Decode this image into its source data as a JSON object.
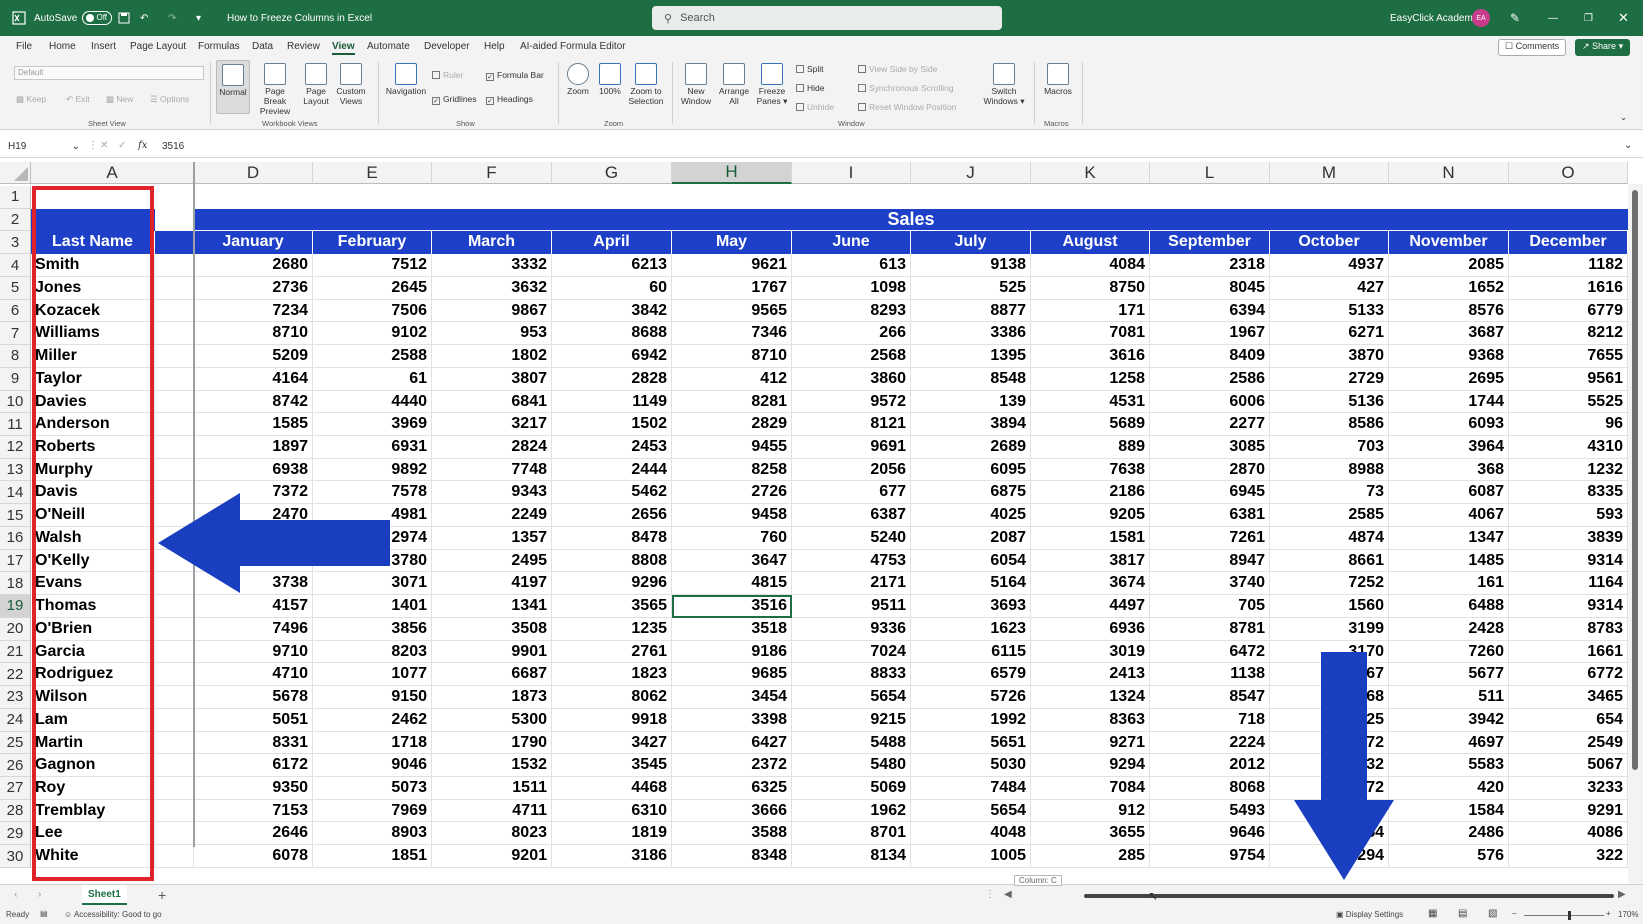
{
  "titlebar": {
    "autosave_label": "AutoSave",
    "autosave_state": "Off",
    "doc_title": "How to Freeze Columns in Excel",
    "search_placeholder": "Search",
    "account_name": "EasyClick Academy",
    "account_initials": "EA"
  },
  "menu": {
    "items": [
      "File",
      "Home",
      "Insert",
      "Page Layout",
      "Formulas",
      "Data",
      "Review",
      "View",
      "Automate",
      "Developer",
      "Help",
      "AI-aided Formula Editor"
    ],
    "active": "View",
    "comments_label": "Comments",
    "share_label": "Share"
  },
  "ribbon": {
    "sheet_view": {
      "combo_value": "Default",
      "keep": "Keep",
      "exit": "Exit",
      "new": "New",
      "options": "Options",
      "label": "Sheet View"
    },
    "workbook_views": {
      "normal": "Normal",
      "page_break": "Page Break Preview",
      "page_layout": "Page Layout",
      "custom_views": "Custom Views",
      "label": "Workbook Views"
    },
    "show": {
      "navigation": "Navigation",
      "ruler": "Ruler",
      "gridlines": "Gridlines",
      "formula_bar": "Formula Bar",
      "headings": "Headings",
      "label": "Show"
    },
    "zoom": {
      "zoom": "Zoom",
      "hundred": "100%",
      "zoom_selection": "Zoom to Selection",
      "label": "Zoom"
    },
    "window": {
      "new_window": "New Window",
      "arrange_all": "Arrange All",
      "freeze_panes": "Freeze Panes",
      "split": "Split",
      "hide": "Hide",
      "unhide": "Unhide",
      "side_by_side": "View Side by Side",
      "sync_scroll": "Synchronous Scrolling",
      "reset_pos": "Reset Window Position",
      "switch_windows": "Switch Windows",
      "label": "Window"
    },
    "macros": {
      "macros": "Macros",
      "label": "Macros"
    }
  },
  "formula_bar": {
    "name_box": "H19",
    "fx": "fx",
    "value": "3516"
  },
  "grid": {
    "columns": [
      "A",
      "D",
      "E",
      "F",
      "G",
      "H",
      "I",
      "J",
      "K",
      "L",
      "M",
      "N",
      "O"
    ],
    "selected_column": "H",
    "selected_row": "19",
    "sales_title": "Sales",
    "headers": [
      "Last Name",
      "January",
      "February",
      "March",
      "April",
      "May",
      "June",
      "July",
      "August",
      "September",
      "October",
      "November",
      "December"
    ],
    "rows": [
      {
        "n": "4",
        "name": "Smith",
        "vals": [
          "2680",
          "7512",
          "3332",
          "6213",
          "9621",
          "613",
          "9138",
          "4084",
          "2318",
          "4937",
          "2085",
          "1182"
        ]
      },
      {
        "n": "5",
        "name": "Jones",
        "vals": [
          "2736",
          "2645",
          "3632",
          "60",
          "1767",
          "1098",
          "525",
          "8750",
          "8045",
          "427",
          "1652",
          "1616"
        ]
      },
      {
        "n": "6",
        "name": "Kozacek",
        "vals": [
          "7234",
          "7506",
          "9867",
          "3842",
          "9565",
          "8293",
          "8877",
          "171",
          "6394",
          "5133",
          "8576",
          "6779"
        ]
      },
      {
        "n": "7",
        "name": "Williams",
        "vals": [
          "8710",
          "9102",
          "953",
          "8688",
          "7346",
          "266",
          "3386",
          "7081",
          "1967",
          "6271",
          "3687",
          "8212"
        ]
      },
      {
        "n": "8",
        "name": "Miller",
        "vals": [
          "5209",
          "2588",
          "1802",
          "6942",
          "8710",
          "2568",
          "1395",
          "3616",
          "8409",
          "3870",
          "9368",
          "7655"
        ]
      },
      {
        "n": "9",
        "name": "Taylor",
        "vals": [
          "4164",
          "61",
          "3807",
          "2828",
          "412",
          "3860",
          "8548",
          "1258",
          "2586",
          "2729",
          "2695",
          "9561"
        ]
      },
      {
        "n": "10",
        "name": "Davies",
        "vals": [
          "8742",
          "4440",
          "6841",
          "1149",
          "8281",
          "9572",
          "139",
          "4531",
          "6006",
          "5136",
          "1744",
          "5525"
        ]
      },
      {
        "n": "11",
        "name": "Anderson",
        "vals": [
          "1585",
          "3969",
          "3217",
          "1502",
          "2829",
          "8121",
          "3894",
          "5689",
          "2277",
          "8586",
          "6093",
          "96"
        ]
      },
      {
        "n": "12",
        "name": "Roberts",
        "vals": [
          "1897",
          "6931",
          "2824",
          "2453",
          "9455",
          "9691",
          "2689",
          "889",
          "3085",
          "703",
          "3964",
          "4310"
        ]
      },
      {
        "n": "13",
        "name": "Murphy",
        "vals": [
          "6938",
          "9892",
          "7748",
          "2444",
          "8258",
          "2056",
          "6095",
          "7638",
          "2870",
          "8988",
          "368",
          "1232"
        ]
      },
      {
        "n": "14",
        "name": "Davis",
        "vals": [
          "7372",
          "7578",
          "9343",
          "5462",
          "2726",
          "677",
          "6875",
          "2186",
          "6945",
          "73",
          "6087",
          "8335"
        ]
      },
      {
        "n": "15",
        "name": "O'Neill",
        "vals": [
          "2470",
          "4981",
          "2249",
          "2656",
          "9458",
          "6387",
          "4025",
          "9205",
          "6381",
          "2585",
          "4067",
          "593"
        ]
      },
      {
        "n": "16",
        "name": "Walsh",
        "vals": [
          "1240",
          "2974",
          "1357",
          "8478",
          "760",
          "5240",
          "2087",
          "1581",
          "7261",
          "4874",
          "1347",
          "3839"
        ]
      },
      {
        "n": "17",
        "name": "O'Kelly",
        "vals": [
          "7810",
          "3780",
          "2495",
          "8808",
          "3647",
          "4753",
          "6054",
          "3817",
          "8947",
          "8661",
          "1485",
          "9314"
        ]
      },
      {
        "n": "18",
        "name": "Evans",
        "vals": [
          "3738",
          "3071",
          "4197",
          "9296",
          "4815",
          "2171",
          "5164",
          "3674",
          "3740",
          "7252",
          "161",
          "1164"
        ]
      },
      {
        "n": "19",
        "name": "Thomas",
        "vals": [
          "4157",
          "1401",
          "1341",
          "3565",
          "3516",
          "9511",
          "3693",
          "4497",
          "705",
          "1560",
          "6488",
          "9314"
        ]
      },
      {
        "n": "20",
        "name": "O'Brien",
        "vals": [
          "7496",
          "3856",
          "3508",
          "1235",
          "3518",
          "9336",
          "1623",
          "6936",
          "8781",
          "3199",
          "2428",
          "8783"
        ]
      },
      {
        "n": "21",
        "name": "Garcia",
        "vals": [
          "9710",
          "8203",
          "9901",
          "2761",
          "9186",
          "7024",
          "6115",
          "3019",
          "6472",
          "3170",
          "7260",
          "1661"
        ]
      },
      {
        "n": "22",
        "name": "Rodriguez",
        "vals": [
          "4710",
          "1077",
          "6687",
          "1823",
          "9685",
          "8833",
          "6579",
          "2413",
          "1138",
          "4767",
          "5677",
          "6772"
        ]
      },
      {
        "n": "23",
        "name": "Wilson",
        "vals": [
          "5678",
          "9150",
          "1873",
          "8062",
          "3454",
          "5654",
          "5726",
          "1324",
          "8547",
          "3968",
          "511",
          "3465"
        ]
      },
      {
        "n": "24",
        "name": "Lam",
        "vals": [
          "5051",
          "2462",
          "5300",
          "9918",
          "3398",
          "9215",
          "1992",
          "8363",
          "718",
          "2725",
          "3942",
          "654"
        ]
      },
      {
        "n": "25",
        "name": "Martin",
        "vals": [
          "8331",
          "1718",
          "1790",
          "3427",
          "6427",
          "5488",
          "5651",
          "9271",
          "2224",
          "6772",
          "4697",
          "2549"
        ]
      },
      {
        "n": "26",
        "name": "Gagnon",
        "vals": [
          "6172",
          "9046",
          "1532",
          "3545",
          "2372",
          "5480",
          "5030",
          "9294",
          "2012",
          "8332",
          "5583",
          "5067"
        ]
      },
      {
        "n": "27",
        "name": "Roy",
        "vals": [
          "9350",
          "5073",
          "1511",
          "4468",
          "6325",
          "5069",
          "7484",
          "7084",
          "8068",
          "4772",
          "420",
          "3233"
        ]
      },
      {
        "n": "28",
        "name": "Tremblay",
        "vals": [
          "7153",
          "7969",
          "4711",
          "6310",
          "3666",
          "1962",
          "5654",
          "912",
          "5493",
          "1584",
          "1584",
          "9291"
        ]
      },
      {
        "n": "29",
        "name": "Lee",
        "vals": [
          "2646",
          "8903",
          "8023",
          "1819",
          "3588",
          "8701",
          "4048",
          "3655",
          "9646",
          "1954",
          "2486",
          "4086"
        ]
      },
      {
        "n": "30",
        "name": "White",
        "vals": [
          "6078",
          "1851",
          "9201",
          "3186",
          "8348",
          "8134",
          "1005",
          "285",
          "9754",
          "2294",
          "576",
          "322"
        ]
      }
    ]
  },
  "sheet": {
    "tab": "Sheet1",
    "add": "+",
    "scroll_tip": "Column: C"
  },
  "status": {
    "ready": "Ready",
    "accessibility": "Accessibility: Good to go",
    "display_settings": "Display Settings",
    "zoom": "170%"
  },
  "colors": {
    "header_blue": "#1e40c8",
    "excel_green": "#1e6e44",
    "annotation_red": "#e0232b",
    "arrow_blue": "#1a3ec0"
  }
}
